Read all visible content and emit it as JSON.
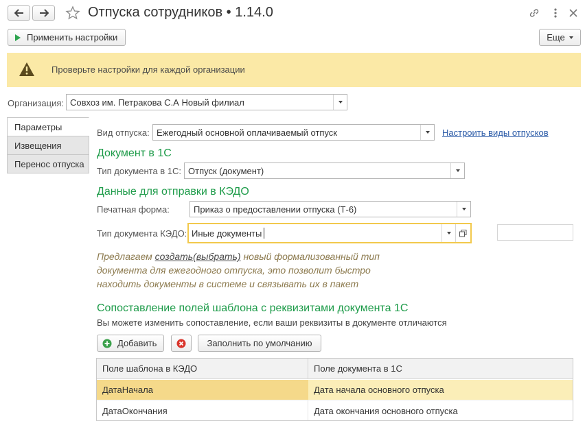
{
  "window": {
    "title": "Отпуска сотрудников • 1.14.0"
  },
  "toolbar": {
    "apply_label": "Применить настройки",
    "more_label": "Еще"
  },
  "warning": {
    "text": "Проверьте настройки для каждой организации"
  },
  "organization": {
    "label": "Организация:",
    "value": "Совхоз им. Петракова С.А Новый филиал"
  },
  "tabs": [
    {
      "label": "Параметры"
    },
    {
      "label": "Извещения"
    },
    {
      "label": "Перенос отпуска"
    }
  ],
  "params": {
    "leave_type_label": "Вид отпуска:",
    "leave_type_value": "Ежегодный основной оплачиваемый отпуск",
    "configure_link": "Настроить виды отпусков",
    "doc1c_heading": "Документ в 1С",
    "doc_type_label": "Тип документа в 1С:",
    "doc_type_value": "Отпуск (документ)",
    "kedo_heading": "Данные для отправки в КЭДО",
    "print_form_label": "Печатная форма:",
    "print_form_value": "Приказ о предоставлении отпуска (Т-6)",
    "kedo_type_label": "Тип документа КЭДО:",
    "kedo_type_value": "Иные документы",
    "hint_prefix": "Предлагаем ",
    "hint_link": "создать(выбрать)",
    "hint_rest": " новый формализованный тип документа для ежегодного отпуска, это позволит быстро находить документы в системе и связывать их в пакет",
    "mapping_heading": "Сопоставление полей шаблона с реквизитами документа 1С",
    "mapping_note": "Вы можете изменить сопоставление, если ваши реквизиты в документе отличаются",
    "add_label": "Добавить",
    "fill_default_label": "Заполнить по умолчанию"
  },
  "table": {
    "headers": [
      "Поле шаблона в КЭДО",
      "Поле документа в 1С"
    ],
    "rows": [
      [
        "ДатаНачала",
        "Дата начала основного отпуска"
      ],
      [
        "ДатаОкончания",
        "Дата окончания основного отпуска"
      ]
    ]
  },
  "colors": {
    "accent_green": "#1d9b49",
    "warning_bg": "#fbe9a6",
    "selected_row": "#fbeeb8",
    "link_blue": "#2a5aa7"
  }
}
